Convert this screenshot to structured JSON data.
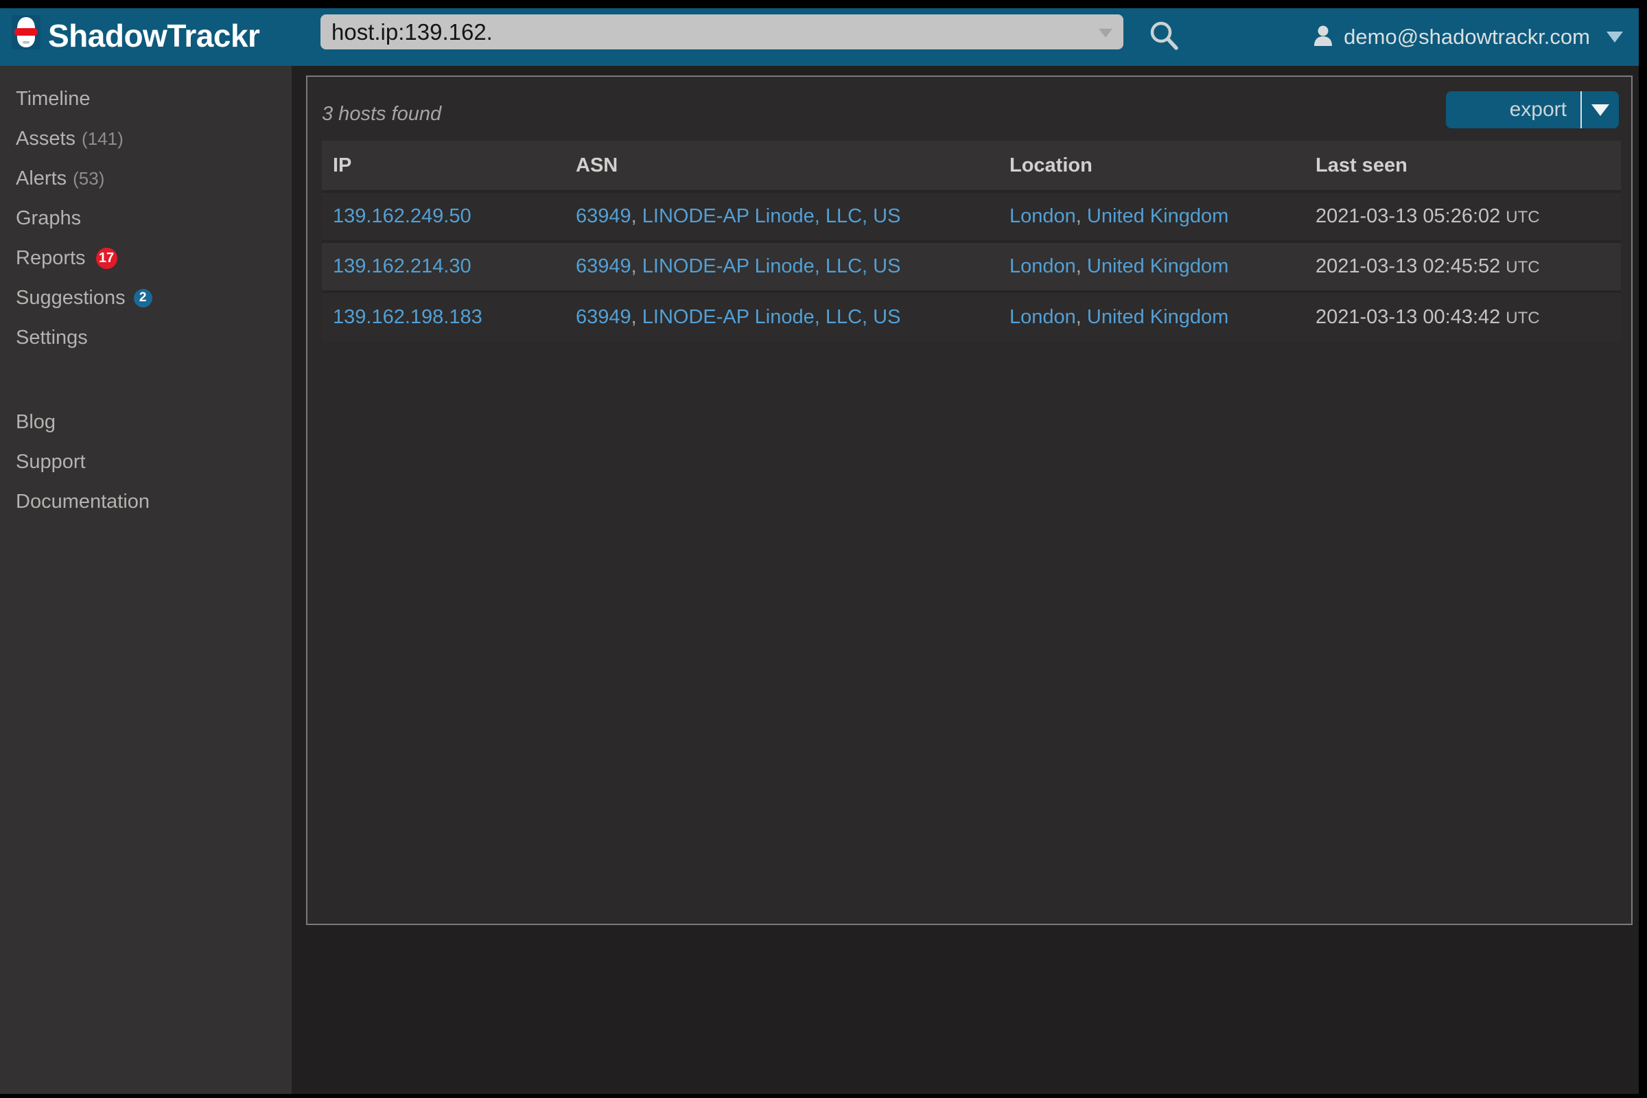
{
  "header": {
    "brand": "ShadowTrackr",
    "search": {
      "value": "host.ip:139.162."
    },
    "account": {
      "email": "demo@shadowtrackr.com"
    }
  },
  "sidebar": {
    "items": [
      {
        "label": "Timeline"
      },
      {
        "label": "Assets",
        "count": "(141)"
      },
      {
        "label": "Alerts",
        "count": "(53)"
      },
      {
        "label": "Graphs"
      },
      {
        "label": "Reports",
        "badge": "17"
      },
      {
        "label": "Suggestions",
        "badge": "2"
      },
      {
        "label": "Settings"
      }
    ],
    "links": [
      {
        "label": "Blog"
      },
      {
        "label": "Support"
      },
      {
        "label": "Documentation"
      }
    ]
  },
  "main": {
    "results_summary": "3 hosts found",
    "export": {
      "label": "export"
    },
    "table": {
      "columns": [
        "IP",
        "ASN",
        "Location",
        "Last seen"
      ],
      "comma": ", ",
      "rows": [
        {
          "ip": "139.162.249.50",
          "asn_number": "63949",
          "asn_org": "LINODE-AP Linode, LLC, US",
          "city": "London",
          "country": "United Kingdom",
          "time": "2021-03-13 05:26:02",
          "tz": "UTC"
        },
        {
          "ip": "139.162.214.30",
          "asn_number": "63949",
          "asn_org": "LINODE-AP Linode, LLC, US",
          "city": "London",
          "country": "United Kingdom",
          "time": "2021-03-13 02:45:52",
          "tz": "UTC"
        },
        {
          "ip": "139.162.198.183",
          "asn_number": "63949",
          "asn_org": "LINODE-AP Linode, LLC, US",
          "city": "London",
          "country": "United Kingdom",
          "time": "2021-03-13 00:43:42",
          "tz": "UTC"
        }
      ]
    }
  },
  "icons": {
    "logo": "helmet-logo",
    "search": "magnifier",
    "account": "person-silhouette",
    "dropdowns": "caret-down"
  },
  "colors": {
    "topbar": "#0d5a7d",
    "link": "#52a0d6",
    "badge_red": "#e11b29",
    "badge_blue": "#1a6a99",
    "search_field": "#c4c4c4",
    "sidebar_bg": "#333131",
    "panel_bg": "#2b2929"
  }
}
